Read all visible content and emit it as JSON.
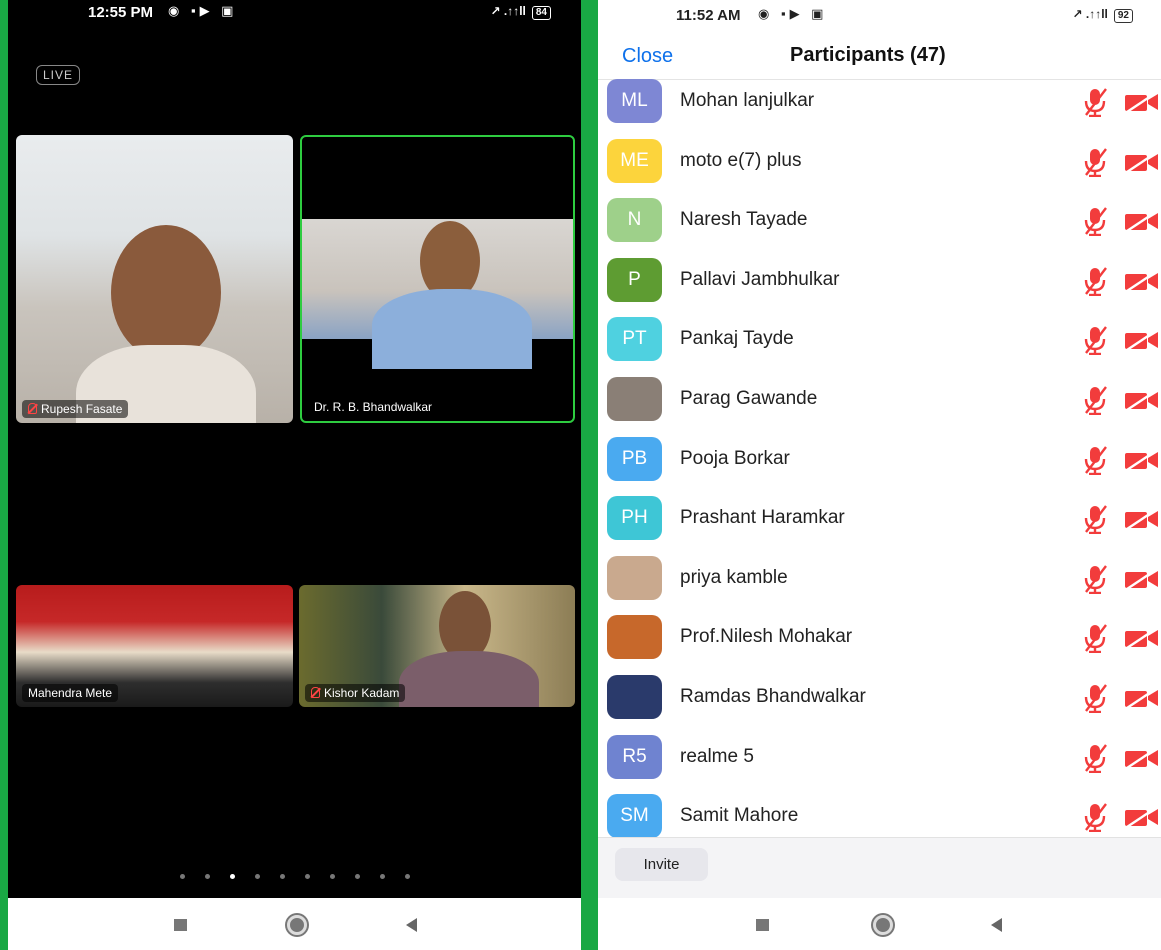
{
  "left_phone": {
    "status": {
      "time": "12:55 PM",
      "signal": "↗ .↑↑ll",
      "battery": "84"
    },
    "live_badge": "LIVE",
    "tiles": {
      "rupesh": "Rupesh Fasate",
      "bhandwalkar": "Dr. R. B. Bhandwalkar",
      "mahendra": "Mahendra Mete",
      "kishor": "Kishor Kadam"
    },
    "page_dots": {
      "count": 10,
      "active_index": 2
    }
  },
  "right_phone": {
    "status": {
      "time": "11:52 AM",
      "signal": "↗ .↑↑ll",
      "battery": "92"
    },
    "header": {
      "close_label": "Close",
      "title": "Participants (47)"
    },
    "participants": [
      {
        "initials": "ML",
        "name": "Mohan lanjulkar",
        "color": "#7e87d4"
      },
      {
        "initials": "ME",
        "name": "moto e(7) plus",
        "color": "#fcd43c"
      },
      {
        "initials": "N",
        "name": "Naresh  Tayade",
        "color": "#9ed08a"
      },
      {
        "initials": "P",
        "name": "Pallavi Jambhulkar",
        "color": "#5e9c32"
      },
      {
        "initials": "PT",
        "name": "Pankaj Tayde",
        "color": "#4fd1e0"
      },
      {
        "initials": "",
        "name": "Parag Gawande",
        "color": "#8a7f76"
      },
      {
        "initials": "PB",
        "name": "Pooja Borkar",
        "color": "#4aaaf0"
      },
      {
        "initials": "PH",
        "name": "Prashant Haramkar",
        "color": "#3ec6d6"
      },
      {
        "initials": "",
        "name": "priya kamble",
        "color": "#c9a98e"
      },
      {
        "initials": "",
        "name": "Prof.Nilesh Mohakar",
        "color": "#c7682b"
      },
      {
        "initials": "",
        "name": "Ramdas Bhandwalkar",
        "color": "#2a3a6b"
      },
      {
        "initials": "R5",
        "name": "realme 5",
        "color": "#6f83d0"
      },
      {
        "initials": "SM",
        "name": "Samit Mahore",
        "color": "#4aaaf0"
      }
    ],
    "invite_label": "Invite"
  },
  "colors": {
    "accent": "#0e71eb",
    "muted": "#f23c3c",
    "frame": "#19a844"
  }
}
